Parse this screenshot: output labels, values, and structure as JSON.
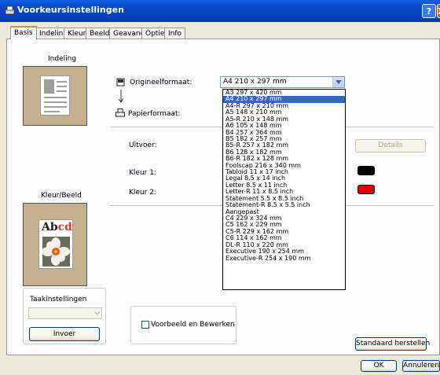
{
  "window": {
    "title": "Voorkeursinstellingen",
    "help_button": "?",
    "close_button": "X"
  },
  "tabs": [
    "Basis",
    "Indeling",
    "Kleur",
    "Beeld",
    "Geavanc.",
    "Optie",
    "Info"
  ],
  "layout_section": {
    "label": "Indeling"
  },
  "color_section": {
    "label": "Kleur/Beeld",
    "sample_text_dark": "Ab",
    "sample_text_red": "cd"
  },
  "original_format": {
    "label": "Origineelformaat:",
    "selected": "A4 210 x 297 mm"
  },
  "paper_format": {
    "label": "Papierformaat:"
  },
  "output": {
    "label": "Uitvoer:",
    "details_button": "Details"
  },
  "colors": {
    "color1_label": "Kleur 1:",
    "color1_swatch": "#000000",
    "color2_label": "Kleur 2:",
    "color2_swatch": "#e00000",
    "accent": "#316ac5"
  },
  "format_options": [
    "A3 297 x 420 mm",
    "A4 210 x 297 mm",
    "A4-R 297 x 210 mm",
    "A5 148 x 210 mm",
    "A5-R 210 x 148 mm",
    "A6 105 x 148 mm",
    "B4 257 x 364 mm",
    "B5 182 x 257 mm",
    "B5-R 257 x 182 mm",
    "B6 128 x 182 mm",
    "B6-R 182 x 128 mm",
    "Foolscap 216 x 340 mm",
    "Tabloid 11 x 17 inch",
    "Legal 8.5 x 14 inch",
    "Letter 8.5 x 11 inch",
    "Letter-R 11 x 8.5 inch",
    "Statement 5.5 x 8.5 inch",
    "Statement-R 8.5 x 5.5 inch",
    "Aangepast",
    "C4 229 x 324 mm",
    "C5 162 x 229 mm",
    "C5-R 229 x 162 mm",
    "C6 114 x 162 mm",
    "DL-R 110 x 220 mm",
    "Executive 190 x 254 mm",
    "Executive-R 254 x 190 mm"
  ],
  "task_settings": {
    "label": "Taakinstellingen",
    "input_button": "Invoer"
  },
  "preview_edit": {
    "label": "Voorbeeld en Bewerken",
    "checked": false
  },
  "restore_button": "Standaard herstellen",
  "ok_button": "OK",
  "cancel_button": "Annuleren"
}
